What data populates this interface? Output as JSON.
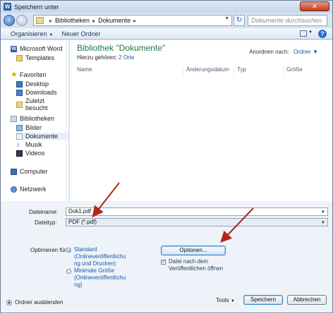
{
  "window": {
    "title": "Speichern unter",
    "close_label": "✕",
    "app_badge": "W"
  },
  "address": {
    "crumbs": [
      "Bibliotheken",
      "Dokumente"
    ],
    "search_placeholder": "Dokumente durchsuchen"
  },
  "toolbar": {
    "organize_label": "Organisieren",
    "new_folder_label": "Neuer Ordner",
    "help": "?"
  },
  "nav": {
    "word": "Microsoft Word",
    "templates": "Templates",
    "favorites": "Favoriten",
    "desktop": "Desktop",
    "downloads": "Downloads",
    "recent": "Zuletzt besucht",
    "libraries": "Bibliotheken",
    "pictures": "Bilder",
    "documents": "Dokumente",
    "music": "Musik",
    "videos": "Videos",
    "computer": "Computer",
    "network": "Netzwerk"
  },
  "content": {
    "title": "Bibliothek \"Dokumente\"",
    "includes_prefix": "Hierzu gehören:",
    "includes_link": "2 Orte",
    "arrange_label": "Anordnen nach:",
    "arrange_value": "Ordner",
    "columns": [
      "Name",
      "Änderungsdatum",
      "Typ",
      "Größe"
    ]
  },
  "form": {
    "filename_label": "Dateiname:",
    "filename_value": "Dok1.pdf",
    "filetype_label": "Dateityp:",
    "filetype_value": "PDF (*.pdf)",
    "optimize_label": "Optimieren für:",
    "radio_standard": "Standard (Onlineveröffentlichung und Drucken)",
    "radio_standard_lines": [
      "Standard",
      "(Onlineveröffentlichu",
      "ng und Drucken)"
    ],
    "radio_min_lines": [
      "Minimale Größe",
      "(Onlineveröffentlichu",
      "ng)"
    ],
    "options_button": "Optionen...",
    "open_after_lines": [
      "Datei nach dem",
      "Veröffentlichen öffnen"
    ],
    "hide_folders": "Ordner ausblenden",
    "tools": "Tools",
    "save": "Speichern",
    "cancel": "Abbrechen"
  },
  "colors": {
    "accent_green": "#1a7a46",
    "link_blue": "#1a57a7",
    "arrow_red": "#b3261e"
  }
}
